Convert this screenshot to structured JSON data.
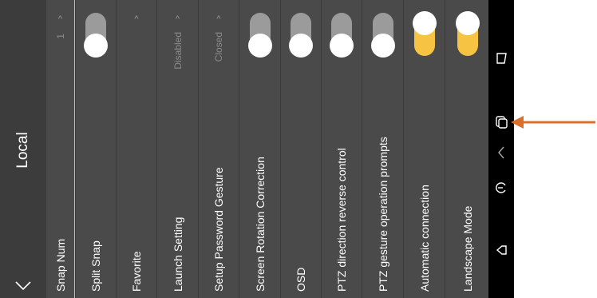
{
  "header": {
    "title": "Local"
  },
  "rows": [
    {
      "label": "Snap Num",
      "value": "1",
      "chevron": "^"
    },
    {
      "label": "Split Snap",
      "toggle": "off"
    },
    {
      "label": "Favorite",
      "chevron": "^"
    },
    {
      "label": "Launch Setting",
      "value": "Disabled",
      "chevron": "^"
    },
    {
      "label": "Setup Password Gesture",
      "value": "Closed",
      "chevron": "^"
    },
    {
      "label": "Screen Rotation Correction",
      "toggle": "off"
    },
    {
      "label": "OSD",
      "toggle": "off"
    },
    {
      "label": "PTZ direction reverse control",
      "toggle": "off"
    },
    {
      "label": "PTZ gesture operation prompts",
      "toggle": "off"
    },
    {
      "label": "Automatic connection",
      "toggle": "on"
    },
    {
      "label": "Landscape Mode",
      "toggle": "on"
    }
  ],
  "colors": {
    "toggle_on": "#f6c442",
    "toggle_off": "#9b9b9b",
    "annotation_arrow": "#d9702c"
  },
  "nav_icons": [
    "recent-apps-icon",
    "overview-icon",
    "expand-chevron-icon",
    "rotate-icon",
    "back-icon"
  ]
}
